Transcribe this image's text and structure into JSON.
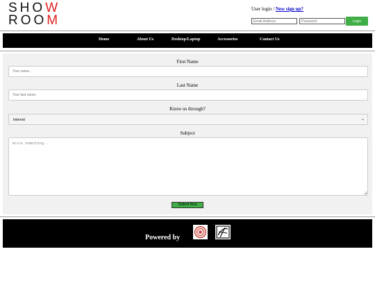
{
  "brand": {
    "logo_top_a": "SHO",
    "logo_top_b": "W",
    "logo_bottom_a": "ROO",
    "logo_bottom_b": "M",
    "accent_color": "#e02020"
  },
  "login": {
    "prompt": "User login",
    "separator": "/",
    "signup_link": "New sign up?",
    "email_placeholder": "Email Address",
    "password_placeholder": "Password",
    "login_label": "Login",
    "button_color": "#3fae46"
  },
  "nav": {
    "items": [
      "Home",
      "About Us",
      "Desktop/Laptop",
      "Accessories",
      "Contact Us"
    ]
  },
  "form": {
    "first_name_label": "First Name",
    "first_name_placeholder": "Your name..",
    "last_name_label": "Last Name",
    "last_name_placeholder": "Your last name..",
    "source_label": "Know us through?",
    "source_selected": "Internet",
    "subject_label": "Subject",
    "subject_placeholder": "Write something..",
    "submit_label": "Submit Now"
  },
  "footer": {
    "powered_by": "Powered by",
    "partner_logos": [
      "seal-logo",
      "emblem-logo"
    ]
  }
}
